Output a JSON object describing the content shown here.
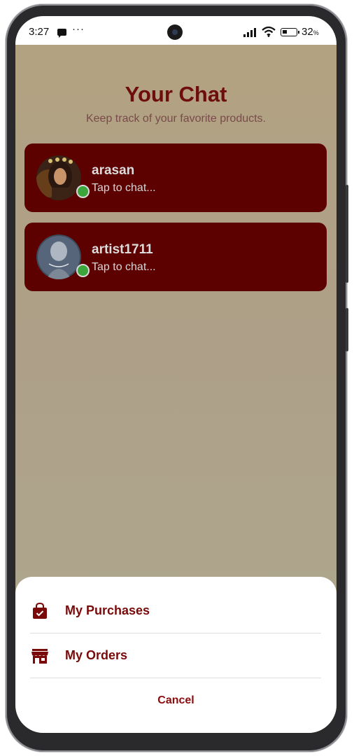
{
  "status_bar": {
    "time": "3:27",
    "more": "···",
    "battery_percent": "32",
    "battery_suffix": "%",
    "icons": [
      "message-icon",
      "signal-icon",
      "wifi-icon",
      "battery-icon"
    ]
  },
  "header": {
    "title": "Your Chat",
    "subtitle": "Keep track of your favorite products."
  },
  "chats": [
    {
      "name": "arasan",
      "preview": "Tap to chat...",
      "online": true
    },
    {
      "name": "artist1711",
      "preview": "Tap to chat...",
      "online": true
    }
  ],
  "sheet": {
    "items": [
      {
        "label": "My Purchases",
        "icon": "shopping-bag-icon"
      },
      {
        "label": "My Orders",
        "icon": "store-icon"
      }
    ],
    "cancel_label": "Cancel"
  },
  "colors": {
    "accent": "#6e0d0d",
    "card": "#5c0000",
    "online": "#3ca63c",
    "background": "#b3a381"
  }
}
